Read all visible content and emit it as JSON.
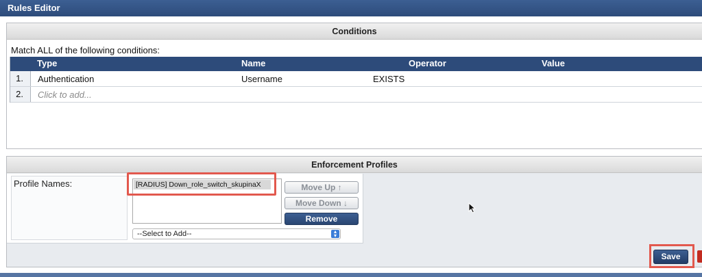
{
  "window": {
    "title": "Rules Editor"
  },
  "conditions": {
    "header": "Conditions",
    "match_text": "Match ALL of the following conditions:",
    "columns": [
      "Type",
      "Name",
      "Operator",
      "Value"
    ],
    "rows": [
      {
        "num": "1.",
        "type": "Authentication",
        "name": "Username",
        "operator": "EXISTS",
        "value": ""
      }
    ],
    "add_row": {
      "num": "2.",
      "placeholder": "Click to add..."
    }
  },
  "enforcement": {
    "header": "Enforcement Profiles",
    "profile_label": "Profile Names:",
    "profiles": [
      "[RADIUS] Down_role_switch_skupinaX"
    ],
    "buttons": {
      "move_up": "Move Up ↑",
      "move_down": "Move Down ↓",
      "remove": "Remove"
    },
    "select_placeholder": "--Select to Add--"
  },
  "footer": {
    "save_label": "Save"
  },
  "colors": {
    "header_blue": "#2d4b7a",
    "highlight_red": "#e2584d",
    "accent_red": "#c22b20"
  }
}
